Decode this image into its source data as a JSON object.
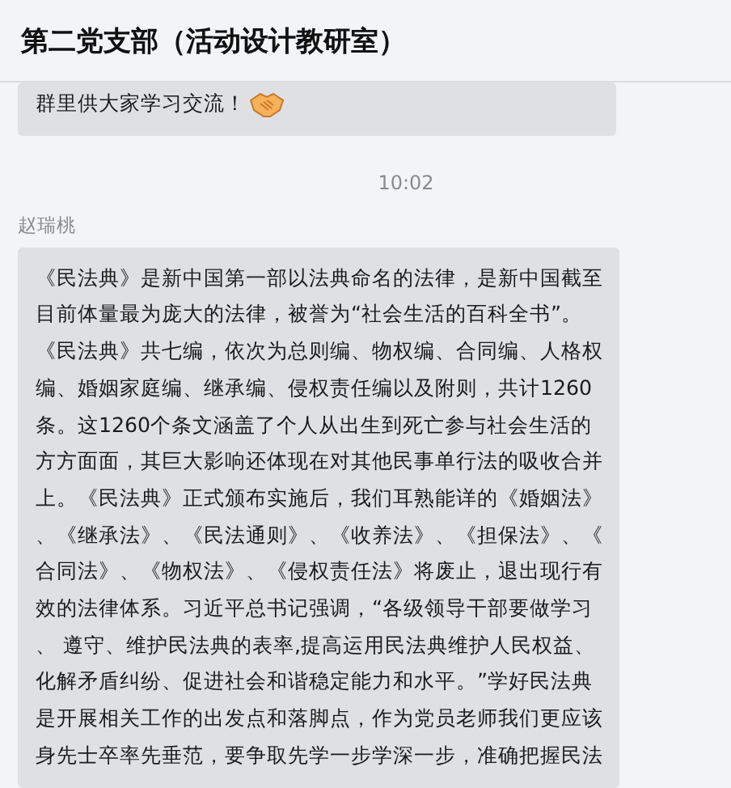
{
  "window": {
    "title": "第二党支部（活动设计教研室）"
  },
  "messages": [
    {
      "kind": "text",
      "lines": [
        "群里供大家学习交流！"
      ],
      "has_emoji": true
    },
    {
      "kind": "time",
      "text": "10:02"
    },
    {
      "kind": "sender",
      "text": "赵瑞桃"
    },
    {
      "kind": "text",
      "lines": [
        "《民法典》是新中国第一部以法典命名的法律，是新中国截至",
        "目前体量最为庞大的法律，被誉为“社会生活的百科全书”。",
        "《民法典》共七编，依次为总则编、物权编、合同编、人格权",
        "编、婚姻家庭编、继承编、侵权责任编以及附则，共计1260",
        "条。这1260个条文涵盖了个人从出生到死亡参与社会生活的",
        "方方面面，其巨大影响还体现在对其他民事单行法的吸收合并",
        "上。《民法典》正式颁布实施后，我们耳熟能详的《婚姻法》",
        "、《继承法》、《民法通则》、《收养法》、《担保法》、《",
        "合同法》、《物权法》、《侵权责任法》将废止，退出现行有",
        "效的法律体系。习近平总书记强调，“各级领导干部要做学习",
        "、 遵守、维护民法典的表率,提高运用民法典维护人民权益、",
        "化解矛盾纠纷、促进社会和谐稳定能力和水平。”学好民法典",
        "是开展相关工作的出发点和落脚点，作为党员老师我们更应该",
        "身先士卒率先垂范，要争取先学一步学深一步，准确把握民法"
      ]
    }
  ]
}
